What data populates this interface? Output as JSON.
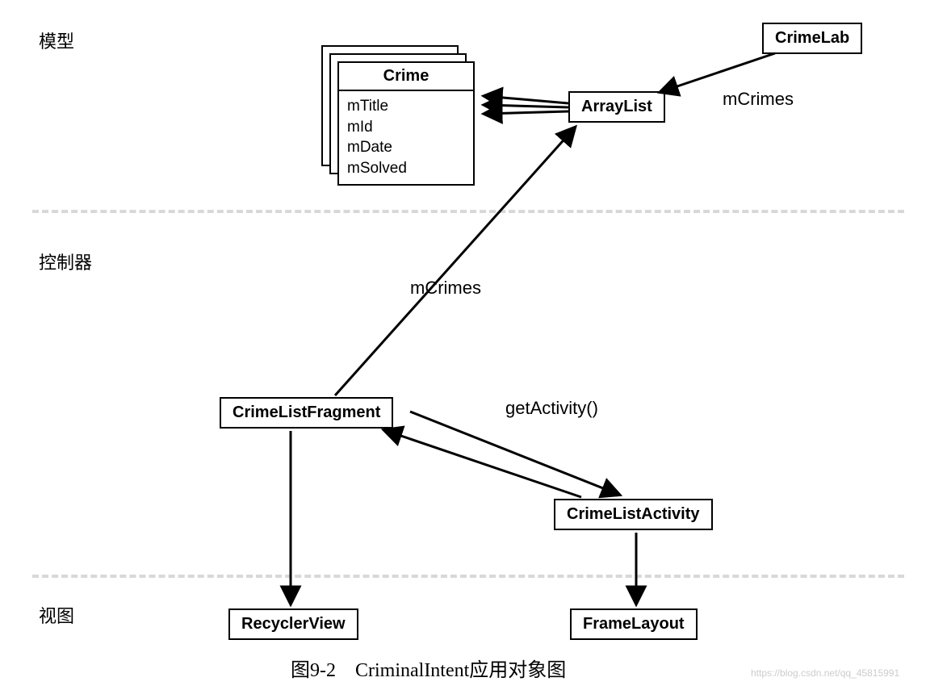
{
  "layers": {
    "model": "模型",
    "controller": "控制器",
    "view": "视图"
  },
  "boxes": {
    "crimeLab": "CrimeLab",
    "arrayList": "ArrayList",
    "crime": {
      "title": "Crime",
      "fields": [
        "mTitle",
        "mId",
        "mDate",
        "mSolved"
      ]
    },
    "crimeListFragment": "CrimeListFragment",
    "crimeListActivity": "CrimeListActivity",
    "recyclerView": "RecyclerView",
    "frameLayout": "FrameLayout"
  },
  "annotations": {
    "mCrimesTop": "mCrimes",
    "mCrimesMid": "mCrimes",
    "getActivity": "getActivity()"
  },
  "caption": "图9-2　CriminalIntent应用对象图",
  "watermark": "https://blog.csdn.net/qq_45815991"
}
